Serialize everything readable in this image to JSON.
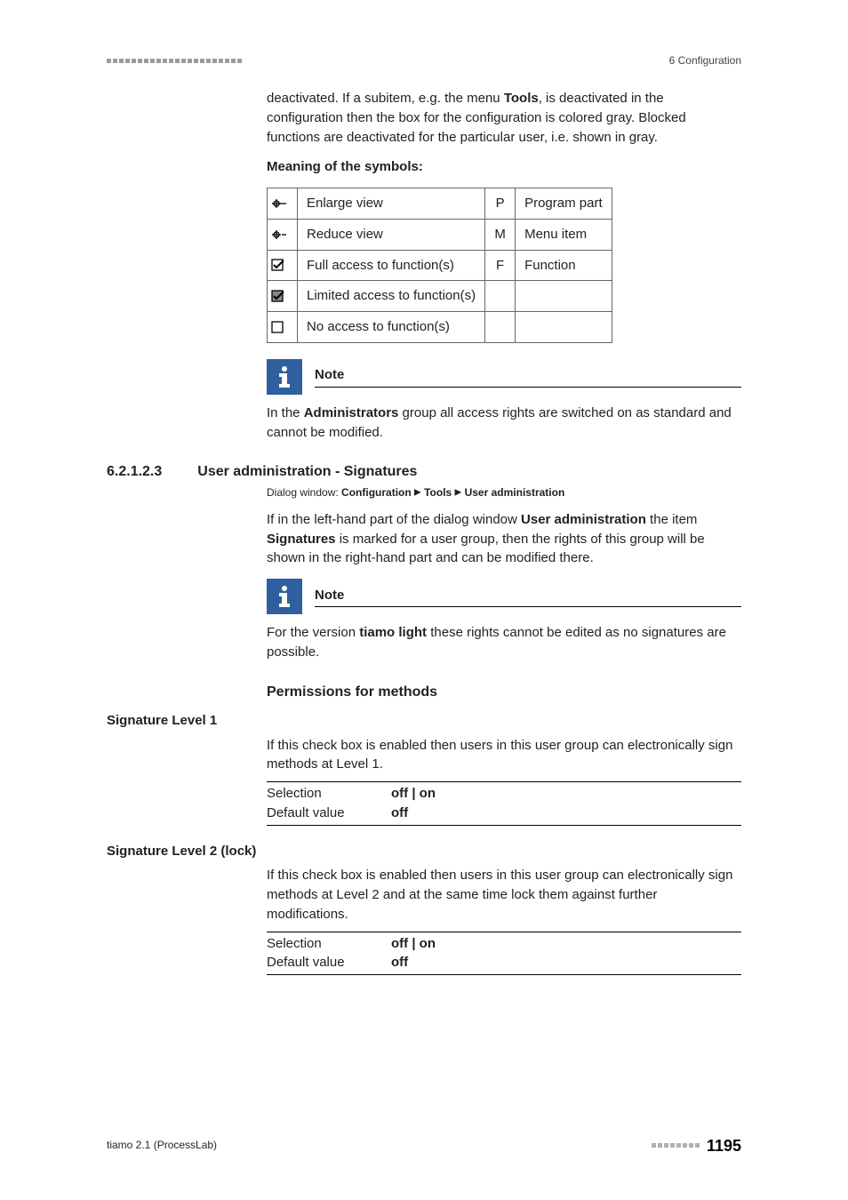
{
  "header": {
    "chapter": "6 Configuration"
  },
  "intro_para": "deactivated. If a subitem, e.g. the menu ",
  "intro_bold": "Tools",
  "intro_rest": ", is deactivated in the configuration then the box for the configuration is colored gray. Blocked functions are deactivated for the particular user, i.e. shown in gray.",
  "meaning_heading": "Meaning of the symbols:",
  "symbols": {
    "rows": [
      {
        "label": "Enlarge view",
        "code": "P",
        "right": "Program part"
      },
      {
        "label": "Reduce view",
        "code": "M",
        "right": "Menu item"
      },
      {
        "label": "Full access to function(s)",
        "code": "F",
        "right": "Function"
      },
      {
        "label": "Limited access to function(s)",
        "code": "",
        "right": ""
      },
      {
        "label": "No access to function(s)",
        "code": "",
        "right": ""
      }
    ]
  },
  "note1": {
    "title": "Note",
    "body_pre": "In the ",
    "body_bold": "Administrators",
    "body_post": " group all access rights are switched on as standard and cannot be modified."
  },
  "section": {
    "num": "6.2.1.2.3",
    "title": "User administration - Signatures"
  },
  "dialog": {
    "label": "Dialog window: ",
    "p1": "Configuration",
    "p2": "Tools",
    "p3": "User administration"
  },
  "sig_para_pre": "If in the left-hand part of the dialog window ",
  "sig_para_b1": "User administration",
  "sig_para_mid": " the item ",
  "sig_para_b2": "Signatures",
  "sig_para_post": " is marked for a user group, then the rights of this group will be shown in the right-hand part and can be modified there.",
  "note2": {
    "title": "Note",
    "body_pre": "For the version ",
    "body_bold": "tiamo light",
    "body_post": " these rights cannot be edited as no signatures are possible."
  },
  "perm_heading": "Permissions for methods",
  "sig1": {
    "label": "Signature Level 1",
    "desc": "If this check box is enabled then users in this user group can electronically sign methods at Level 1.",
    "sel_label": "Selection",
    "sel_val": "off | on",
    "def_label": "Default value",
    "def_val": "off"
  },
  "sig2": {
    "label": "Signature Level 2 (lock)",
    "desc": "If this check box is enabled then users in this user group can electronically sign methods at Level 2 and at the same time lock them against further modifications.",
    "sel_label": "Selection",
    "sel_val": "off | on",
    "def_label": "Default value",
    "def_val": "off"
  },
  "footer": {
    "left": "tiamo 2.1 (ProcessLab)",
    "page": "1195"
  }
}
